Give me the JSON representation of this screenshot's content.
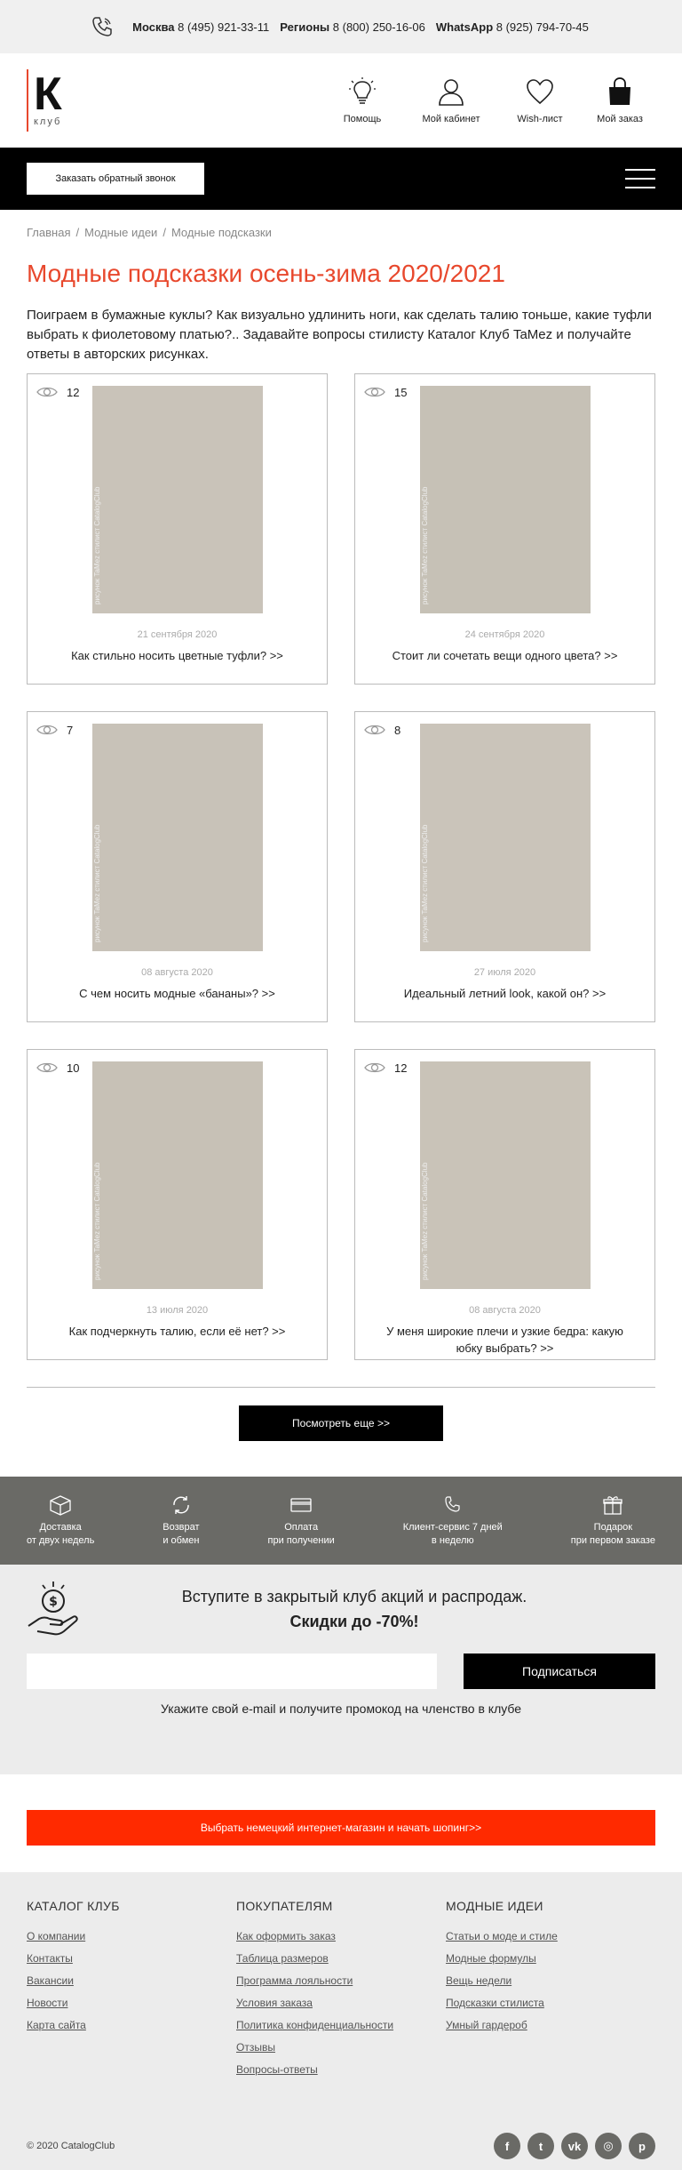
{
  "topbar": {
    "moscow_label": "Москва",
    "moscow_phone": "8 (495) 921-33-11",
    "regions_label": "Регионы",
    "regions_phone": "8 (800) 250-16-06",
    "whatsapp_label": "WhatsApp",
    "whatsapp_phone": "8 (925) 794-70-45"
  },
  "logo": {
    "letter": "К",
    "sub": "клуб"
  },
  "nav": [
    {
      "label": "Помощь",
      "icon": "bulb-icon"
    },
    {
      "label": "Мой кабинет",
      "icon": "user-icon"
    },
    {
      "label": "Wish-лист",
      "icon": "heart-icon"
    },
    {
      "label": "Мой заказ",
      "icon": "bag-icon"
    }
  ],
  "callbar": {
    "callback_label": "Заказать обратный звонок"
  },
  "breadcrumbs": [
    "Главная",
    "Модные идеи",
    "Модные подсказки"
  ],
  "page_title": "Модные подсказки осень-зима 2020/2021",
  "intro": "Поиграем в бумажные куклы? Как визуально удлинить ноги, как сделать талию тоньше, какие туфли выбрать к фиолетовому платью?.. Задавайте вопросы стилисту Каталог Клуб TaMez и получайте ответы в авторских рисунках.",
  "watermark": "рисунок TaMez стилист CatalogClub",
  "cards": [
    {
      "views": "12",
      "date": "21 сентября 2020",
      "title": "Как стильно носить цветные туфли? >>",
      "img_color": "#c9c3b9"
    },
    {
      "views": "15",
      "date": "24 сентября 2020",
      "title": "Стоит ли сочетать вещи одного цвета? >>",
      "img_color": "#c6c1b6"
    },
    {
      "views": "7",
      "date": "08 августа 2020",
      "title": "С чем носить модные «бананы»? >>",
      "img_color": "#c8c2b8"
    },
    {
      "views": "8",
      "date": "27 июля 2020",
      "title": "Идеальный летний look, какой он? >>",
      "img_color": "#cac4ba"
    },
    {
      "views": "10",
      "date": "13 июля 2020",
      "title": "Как подчеркнуть талию, если её нет? >>",
      "img_color": "#c7c1b6"
    },
    {
      "views": "12",
      "date": "08 августа 2020",
      "title": "У меня широкие плечи и узкие бедра: какую юбку выбрать? >>",
      "img_color": "#c9c3b8"
    }
  ],
  "more_label": "Посмотреть еще >>",
  "benefits": [
    {
      "line1": "Доставка",
      "line2": "от двух недель",
      "icon": "box-icon"
    },
    {
      "line1": "Возврат",
      "line2": "и обмен",
      "icon": "refresh-icon"
    },
    {
      "line1": "Оплата",
      "line2": "при получении",
      "icon": "card-icon"
    },
    {
      "line1": "Клиент-сервис 7 дней",
      "line2": "в неделю",
      "icon": "phone-icon"
    },
    {
      "line1": "Подарок",
      "line2": "при первом заказе",
      "icon": "gift-icon"
    }
  ],
  "subscribe": {
    "headline": "Вступите в закрытый клуб акций и распродаж.",
    "headline_bold": "Скидки до -70%!",
    "placeholder": "",
    "button": "Подписаться",
    "hint": "Укажите свой e-mail и получите промокод на членство в клубе"
  },
  "shop_button": "Выбрать немецкий интернет-магазин и начать шопинг>>",
  "footer": {
    "columns": [
      {
        "title": "КАТАЛОГ КЛУБ",
        "links": [
          "О компании",
          "Контакты",
          "Вакансии",
          "Новости",
          "Карта сайта"
        ]
      },
      {
        "title": "ПОКУПАТЕЛЯМ",
        "links": [
          "Как оформить заказ",
          "Таблица размеров",
          "Программа лояльности",
          "Условия заказа",
          "Политика конфиденциальности",
          "Отзывы",
          "Вопросы-ответы"
        ]
      },
      {
        "title": "МОДНЫЕ ИДЕИ",
        "links": [
          "Статьи о моде и стиле",
          "Модные формулы",
          "Вещь недели",
          "Подсказки стилиста",
          "Умный гардероб"
        ]
      }
    ],
    "copyright": "© 2020 CatalogClub",
    "socials": [
      {
        "icon": "facebook-icon",
        "glyph": "f"
      },
      {
        "icon": "twitter-icon",
        "glyph": "t"
      },
      {
        "icon": "vk-icon",
        "glyph": "vk"
      },
      {
        "icon": "instagram-icon",
        "glyph": "◎"
      },
      {
        "icon": "pinterest-icon",
        "glyph": "p"
      }
    ]
  },
  "colors": {
    "accent": "#e8482d",
    "orange_button": "#ff2a00",
    "benefits_bg": "#6a6a66"
  }
}
